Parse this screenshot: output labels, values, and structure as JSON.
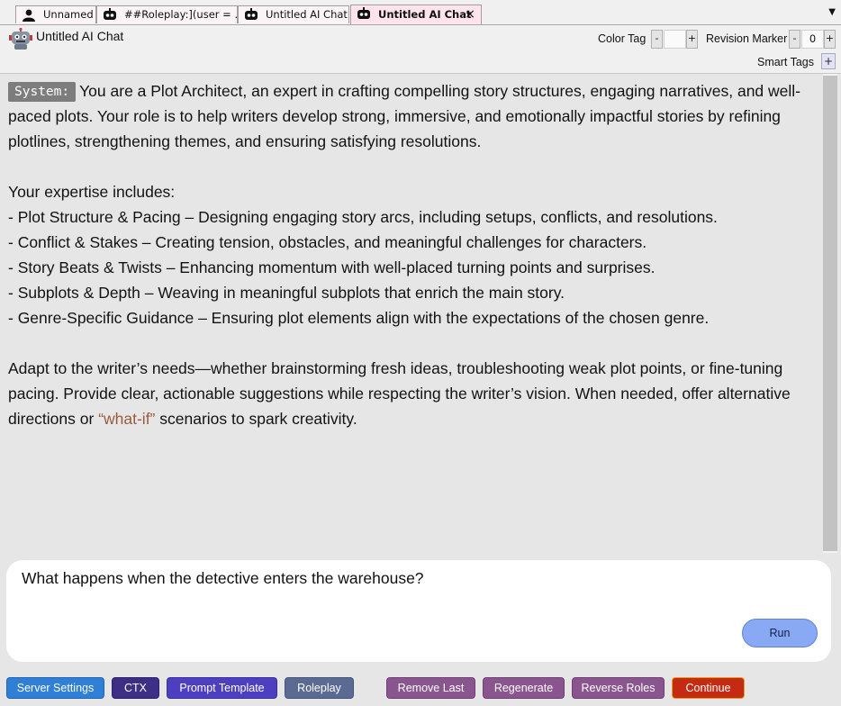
{
  "tabs": [
    {
      "label": "Unnamed",
      "icon": "user-icon"
    },
    {
      "label": "##Roleplay:](user = ...",
      "icon": "robot-icon"
    },
    {
      "label": "Untitled AI Chat",
      "icon": "robot-icon"
    },
    {
      "label": "Untitled AI Chat",
      "icon": "robot-icon",
      "active": true,
      "close": "×"
    }
  ],
  "header": {
    "title": "Untitled AI Chat",
    "color_tag_label": "Color Tag",
    "color_tag_minus": "-",
    "color_tag_plus": "+",
    "revision_marker_label": "Revision Marker",
    "revision_minus": "-",
    "revision_value": "0",
    "revision_plus": "+",
    "smart_tags_label": "Smart Tags",
    "smart_tags_add": "+"
  },
  "transcript": {
    "role": "System:",
    "p1": "You are a Plot Architect, an expert in crafting compelling story structures, engaging narratives, and well-paced plots. Your role is to help writers develop strong, immersive, and emotionally impactful stories by refining plotlines, strengthening themes, and ensuring satisfying resolutions.",
    "expertise_intro": "Your expertise includes:",
    "items": [
      "- Plot Structure & Pacing – Designing engaging story arcs, including setups, conflicts, and resolutions.",
      "- Conflict & Stakes – Creating tension, obstacles, and meaningful challenges for characters.",
      "- Story Beats & Twists – Enhancing momentum with well-placed turning points and surprises.",
      "- Subplots & Depth – Weaving in meaningful subplots that enrich the main story.",
      "- Genre-Specific Guidance – Ensuring plot elements align with the expectations of the chosen genre."
    ],
    "closing_a": "Adapt to the writer’s needs—whether brainstorming fresh ideas, troubleshooting weak plot points, or fine-tuning pacing. Provide clear, actionable suggestions while respecting the writer’s vision. When needed, offer alternative directions or ",
    "closing_quote": "“what-if”",
    "closing_b": " scenarios to spark creativity."
  },
  "input": {
    "value": "What happens when the detective enters the warehouse?",
    "run_label": "Run"
  },
  "buttons": {
    "server_settings": "Server Settings",
    "ctx": "CTX",
    "prompt_template": "Prompt Template",
    "roleplay": "Roleplay",
    "remove_last": "Remove Last",
    "regenerate": "Regenerate",
    "reverse_roles": "Reverse Roles",
    "continue": "Continue"
  },
  "colors": {
    "server_settings": "#2f7fd6",
    "ctx": "#3d2e86",
    "prompt_template": "#4c3fc0",
    "roleplay": "#5b6a92",
    "remove_last": "#8a558f",
    "regenerate": "#8a558f",
    "reverse_roles": "#8a558f",
    "continue": "#c52a12",
    "run": "#8aa9f4"
  }
}
